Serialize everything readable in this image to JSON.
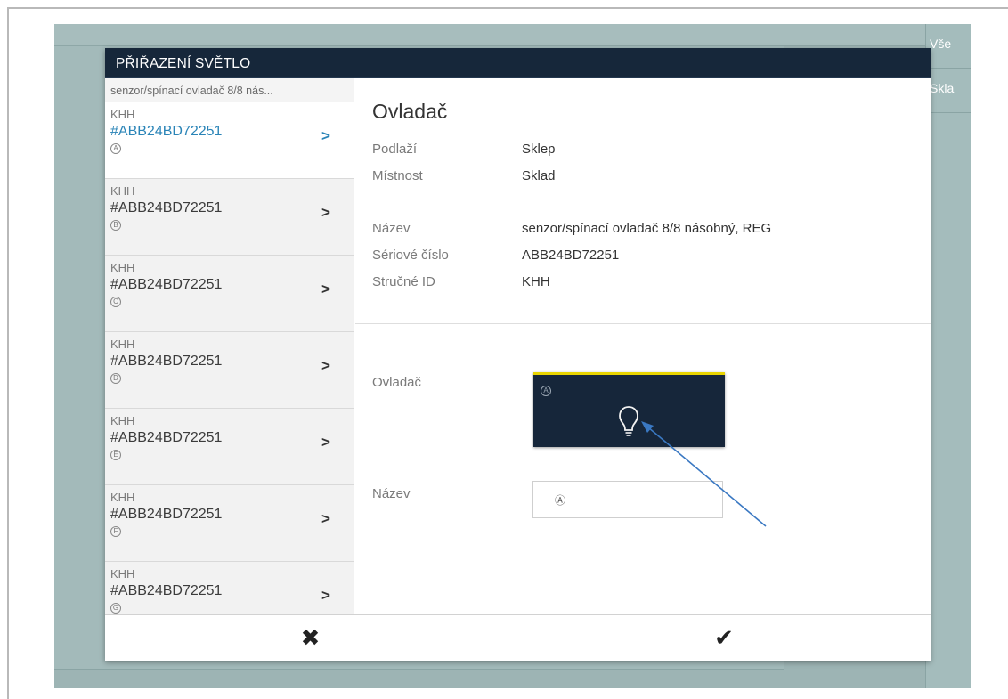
{
  "dialog": {
    "title": "PŘIŘAZENÍ SVĚTLO"
  },
  "background_panel": {
    "items": [
      "Vše",
      "Skla"
    ]
  },
  "list": {
    "header": "senzor/spínací ovladač 8/8 nás...",
    "items": [
      {
        "short_id": "KHH",
        "serial": "#ABB24BD72251",
        "badge": "A",
        "active": true
      },
      {
        "short_id": "KHH",
        "serial": "#ABB24BD72251",
        "badge": "B",
        "active": false
      },
      {
        "short_id": "KHH",
        "serial": "#ABB24BD72251",
        "badge": "C",
        "active": false
      },
      {
        "short_id": "KHH",
        "serial": "#ABB24BD72251",
        "badge": "D",
        "active": false
      },
      {
        "short_id": "KHH",
        "serial": "#ABB24BD72251",
        "badge": "E",
        "active": false
      },
      {
        "short_id": "KHH",
        "serial": "#ABB24BD72251",
        "badge": "F",
        "active": false
      },
      {
        "short_id": "KHH",
        "serial": "#ABB24BD72251",
        "badge": "G",
        "active": false
      }
    ]
  },
  "details": {
    "title": "Ovladač",
    "floor_label": "Podlaží",
    "floor_value": "Sklep",
    "room_label": "Místnost",
    "room_value": "Sklad",
    "name_label": "Název",
    "name_value": "senzor/spínací ovladač 8/8 násobný, REG",
    "serial_label": "Sériové číslo",
    "serial_value": "ABB24BD72251",
    "short_id_label": "Stručné ID",
    "short_id_value": "KHH"
  },
  "config": {
    "control_label": "Ovladač",
    "tile_badge": "A",
    "tile_icon": "light-bulb-icon",
    "name_label": "Název",
    "name_input_value": "Ⓐ"
  },
  "footer": {
    "cancel_icon": "close-icon",
    "cancel_glyph": "✖",
    "confirm_icon": "checkmark-icon",
    "confirm_glyph": "✔"
  },
  "colors": {
    "titlebar": "#16273a",
    "tile": "#16263a",
    "tile_accent": "#e8d400",
    "active_link": "#2a84b7",
    "overlay": "#9db4b4"
  }
}
